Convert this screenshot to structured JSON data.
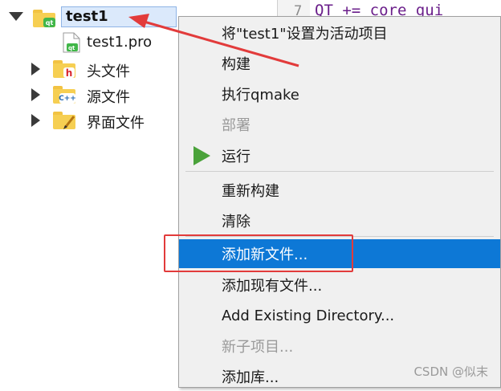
{
  "tree": {
    "project": {
      "name": "test1",
      "icon": "qt-project-folder-icon"
    },
    "pro_file": {
      "name": "test1.pro",
      "icon": "qt-pro-file-icon"
    },
    "folders": [
      {
        "label": "头文件",
        "icon": "headers-folder-icon",
        "badge": "h",
        "badge_color": "#d9252c"
      },
      {
        "label": "源文件",
        "icon": "sources-folder-icon",
        "badge": "C++",
        "badge_color": "#2469b3"
      },
      {
        "label": "界面文件",
        "icon": "forms-folder-icon",
        "badge": "✎",
        "badge_color": "#c98a1a"
      }
    ]
  },
  "editor": {
    "line_number": "7",
    "code": "QT      += core gui"
  },
  "menu": {
    "items": [
      {
        "label": "将\"test1\"设置为活动项目",
        "enabled": true
      },
      {
        "label": "构建",
        "enabled": true
      },
      {
        "label": "执行qmake",
        "enabled": true
      },
      {
        "label": "部署",
        "enabled": false
      },
      {
        "label": "运行",
        "enabled": true,
        "icon": "run-icon"
      },
      {
        "label": "重新构建",
        "enabled": true
      },
      {
        "label": "清除",
        "enabled": true
      },
      {
        "label": "添加新文件...",
        "enabled": true,
        "highlighted": true
      },
      {
        "label": "添加现有文件...",
        "enabled": true
      },
      {
        "label": "Add Existing Directory...",
        "enabled": true
      },
      {
        "label": "新子项目...",
        "enabled": false
      },
      {
        "label": "添加库...",
        "enabled": true
      }
    ]
  },
  "annotation": {
    "arrow_color": "#e23b3b",
    "box_color": "#e23b3b"
  },
  "watermark": "CSDN @似末",
  "colors": {
    "highlight": "#0d78d6",
    "accent_green": "#4aa23a",
    "folder": "#f6cf52"
  }
}
